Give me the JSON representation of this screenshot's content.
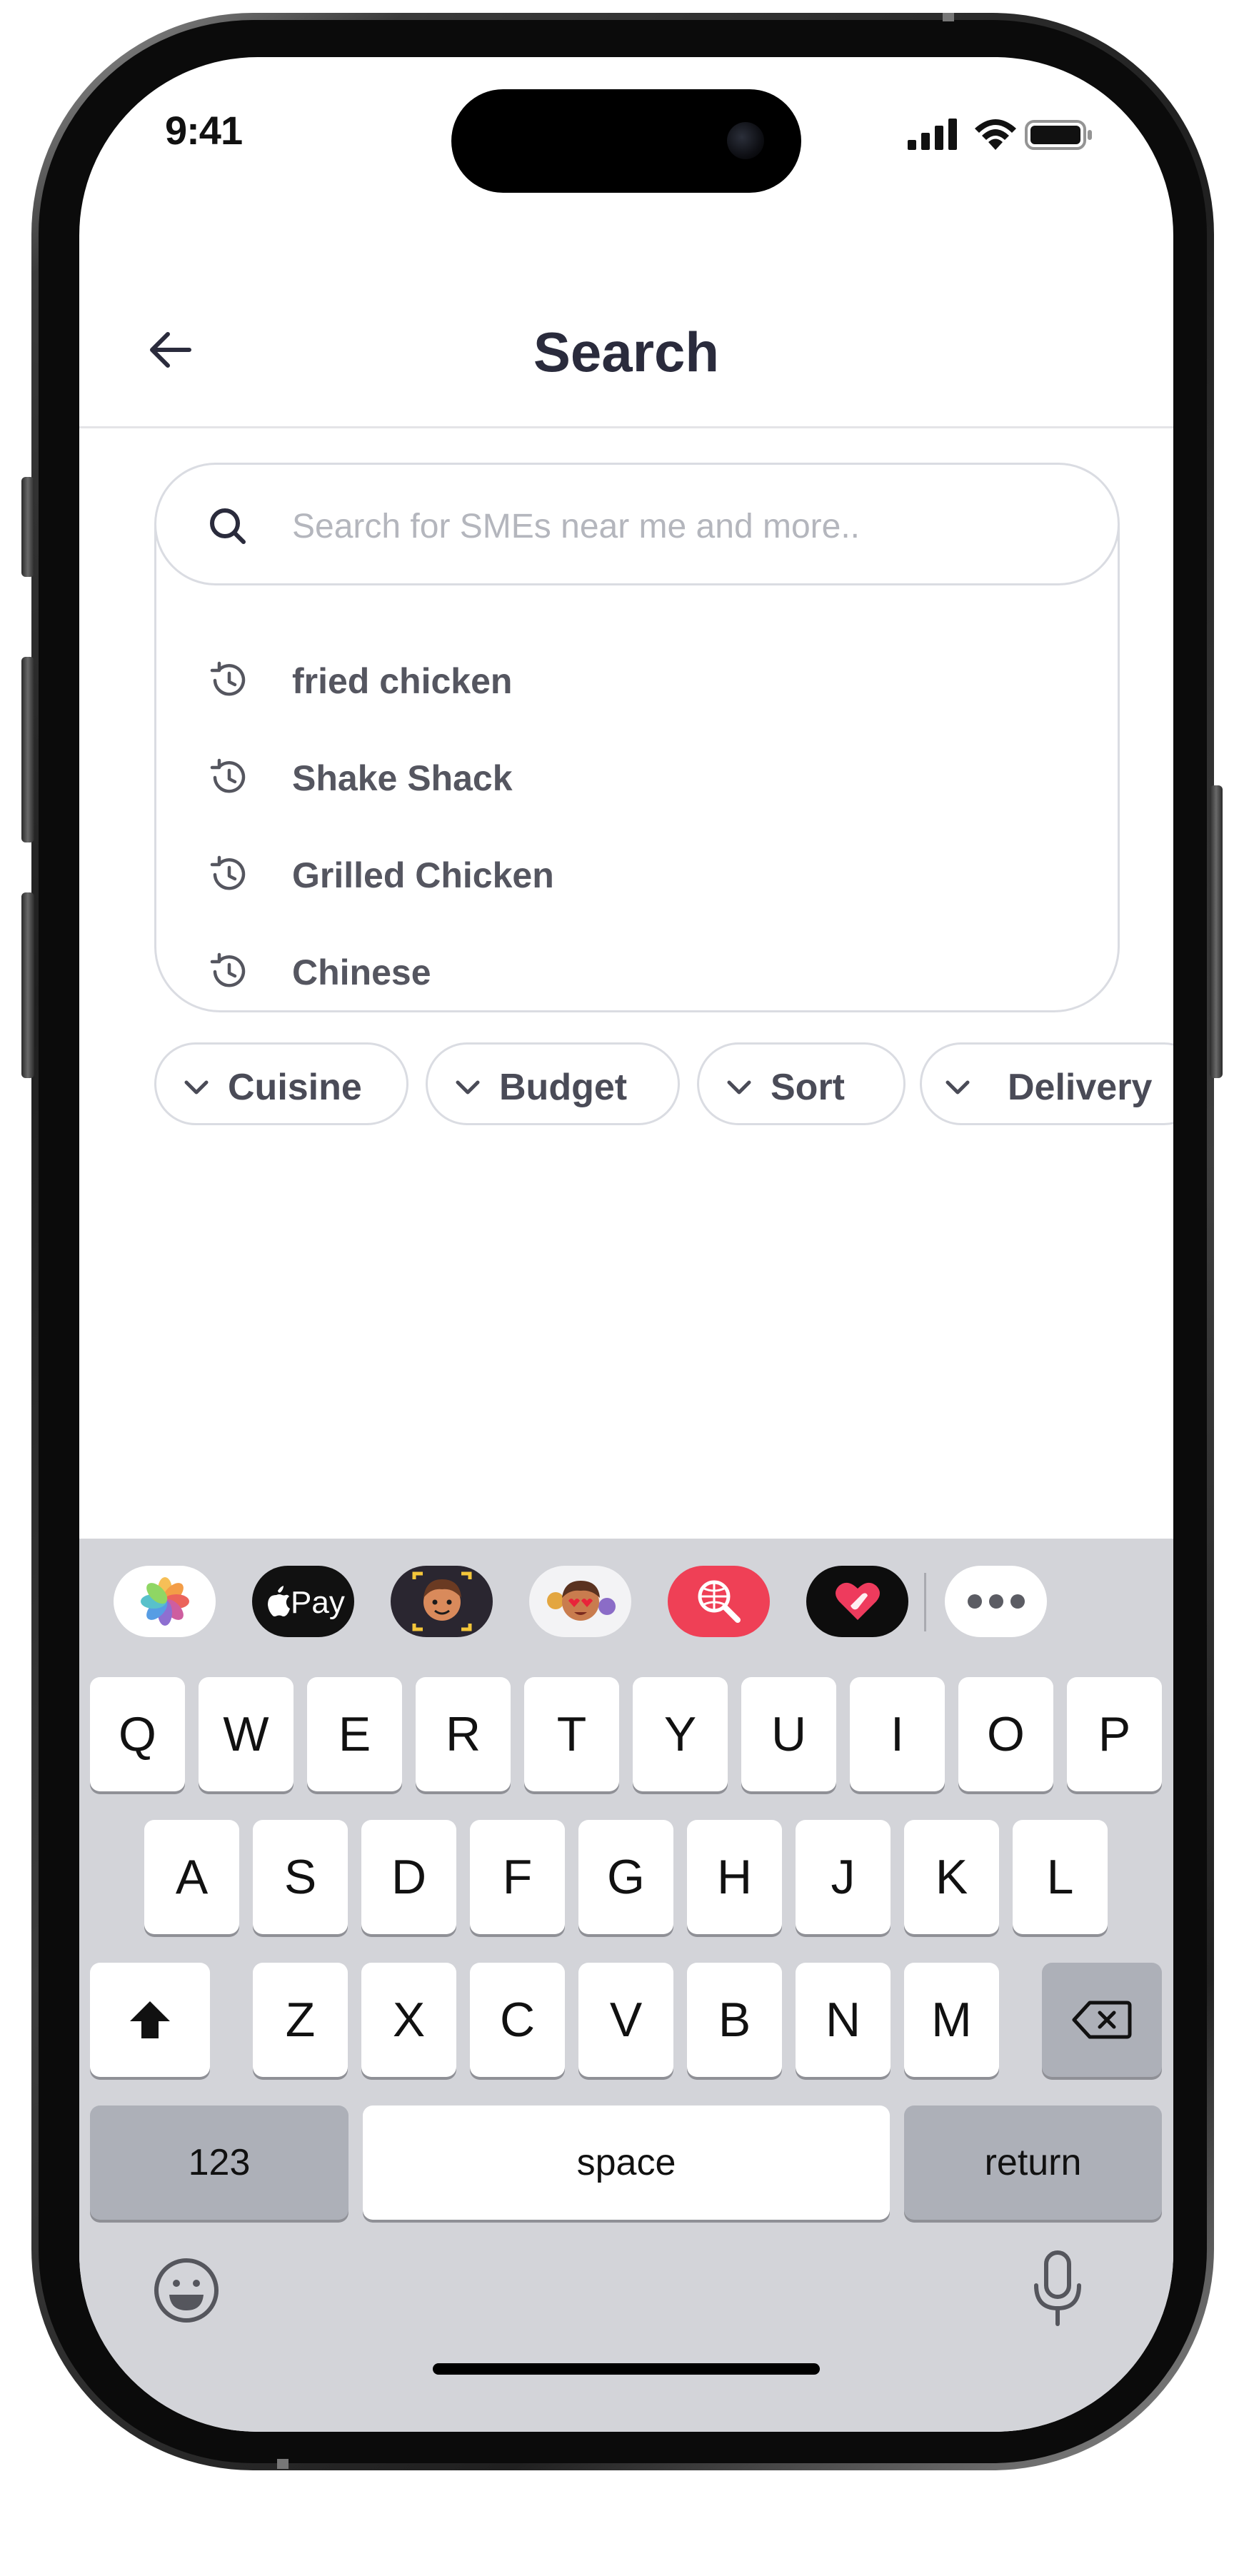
{
  "status_bar": {
    "time": "9:41",
    "icons": [
      "signal-icon",
      "wifi-icon",
      "battery-icon"
    ]
  },
  "header": {
    "title": "Search",
    "back_icon": "arrow-left-icon"
  },
  "search": {
    "placeholder": "Search for SMEs near me and more..",
    "value": "",
    "history": [
      {
        "label": "fried chicken",
        "icon": "history-icon"
      },
      {
        "label": "Shake Shack",
        "icon": "history-icon"
      },
      {
        "label": "Grilled Chicken",
        "icon": "history-icon"
      },
      {
        "label": "Chinese",
        "icon": "history-icon"
      }
    ]
  },
  "filters": [
    {
      "label": "Cuisine",
      "icon": "chevron-down-icon"
    },
    {
      "label": "Budget",
      "icon": "chevron-down-icon"
    },
    {
      "label": "Sort",
      "icon": "chevron-down-icon"
    },
    {
      "label": "Delivery",
      "icon": "chevron-down-icon"
    }
  ],
  "keyboard": {
    "apps": [
      {
        "name": "photos-app-icon"
      },
      {
        "name": "apple-pay-icon",
        "label": "Pay"
      },
      {
        "name": "memoji-icon"
      },
      {
        "name": "memoji-stickers-icon"
      },
      {
        "name": "web-search-icon"
      },
      {
        "name": "digital-touch-icon"
      },
      {
        "name": "more-apps-icon"
      }
    ],
    "row1": [
      "Q",
      "W",
      "E",
      "R",
      "T",
      "Y",
      "U",
      "I",
      "O",
      "P"
    ],
    "row2": [
      "A",
      "S",
      "D",
      "F",
      "G",
      "H",
      "J",
      "K",
      "L"
    ],
    "row3": [
      "Z",
      "X",
      "C",
      "V",
      "B",
      "N",
      "M"
    ],
    "numbers_label": "123",
    "space_label": "space",
    "return_label": "return",
    "colors": {
      "key": "#ffffff",
      "dark_key": "#adb0b8",
      "background": "#d3d4d9"
    }
  },
  "colors": {
    "title": "#2a2b3c",
    "border": "#dadce2",
    "placeholder": "#b4b6bd",
    "history_text": "#555660",
    "web_search_red": "#ef4056"
  }
}
